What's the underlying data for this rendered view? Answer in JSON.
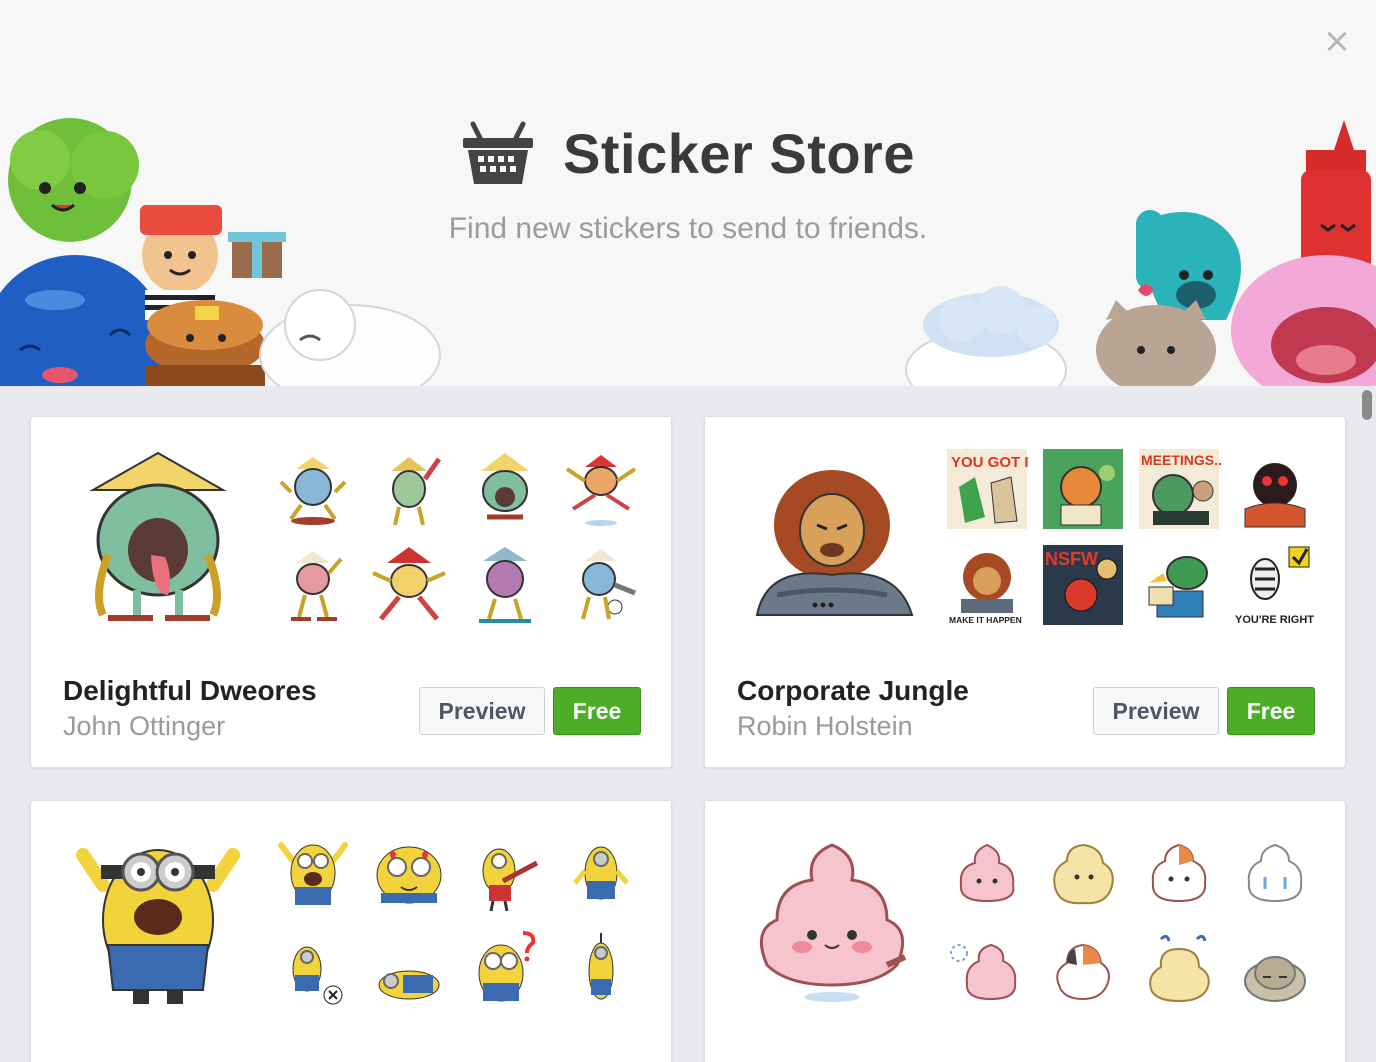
{
  "window": {
    "close_icon": "close-icon",
    "close_glyph": "×"
  },
  "header": {
    "icon": "basket-icon",
    "title": "Sticker Store",
    "subtitle": "Find new stickers to send to friends."
  },
  "packs": [
    {
      "name": "Delightful Dweores",
      "author": "John Ottinger",
      "preview_label": "Preview",
      "price_label": "Free",
      "theme_color": "#7fbfa0"
    },
    {
      "name": "Corporate Jungle",
      "author": "Robin Holstein",
      "preview_label": "Preview",
      "price_label": "Free",
      "theme_color": "#a64a24",
      "sticker_captions": [
        "YOU GOT IT",
        "MEETINGS...",
        "NSFW",
        "MAKE IT HAPPEN",
        "YOU'RE RIGHT"
      ]
    },
    {
      "name": "",
      "author": "",
      "theme_color": "#f3d33c"
    },
    {
      "name": "",
      "author": "",
      "theme_color": "#f5c4cf"
    }
  ],
  "colors": {
    "accent_green": "#4cae26",
    "page_background": "#e9eaed"
  }
}
